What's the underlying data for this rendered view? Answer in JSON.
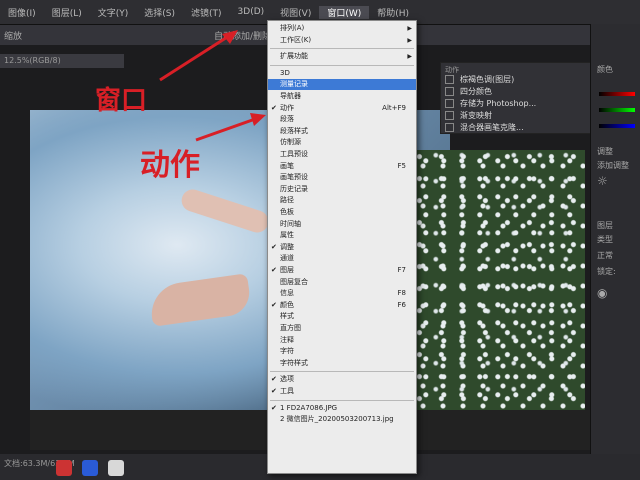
{
  "menubar": {
    "items": [
      {
        "label": "图像(I)"
      },
      {
        "label": "图层(L)"
      },
      {
        "label": "文字(Y)"
      },
      {
        "label": "选择(S)"
      },
      {
        "label": "滤镜(T)"
      },
      {
        "label": "3D(D)"
      },
      {
        "label": "视图(V)"
      },
      {
        "label": "窗口(W)"
      },
      {
        "label": "帮助(H)"
      }
    ]
  },
  "options_bar": {
    "label1": "缩放",
    "auto_add": "自动添加/删除"
  },
  "doc_tab": "12.5%(RGB/8)",
  "status_bar": {
    "doc_size": "文档:63.3M/63.3M"
  },
  "actions_panel": {
    "header": "动作",
    "rows": [
      {
        "label": "棕褐色调(图层)"
      },
      {
        "label": "四分颜色"
      },
      {
        "label": "存储为 Photoshop..."
      },
      {
        "label": "渐变映射"
      },
      {
        "label": "混合器画笔克隆..."
      }
    ]
  },
  "right_panel": {
    "color_tab": "颜色",
    "adjust_tab": "调整",
    "add_adjust": "添加调整",
    "layers_tab": "图层",
    "kind_label": "类型",
    "blend_mode": "正常",
    "lock_label": "锁定:"
  },
  "window_menu": {
    "items": [
      {
        "label": "排列(A)",
        "submenu": true
      },
      {
        "label": "工作区(K)",
        "submenu": true
      },
      {
        "sep": true
      },
      {
        "label": "扩展功能",
        "submenu": true
      },
      {
        "sep": true
      },
      {
        "label": "3D"
      },
      {
        "label": "测量记录",
        "highlighted": true
      },
      {
        "label": "导航器"
      },
      {
        "label": "动作",
        "checked": true,
        "shortcut": "Alt+F9"
      },
      {
        "label": "段落"
      },
      {
        "label": "段落样式"
      },
      {
        "label": "仿制源"
      },
      {
        "label": "工具预设"
      },
      {
        "label": "画笔",
        "shortcut": "F5"
      },
      {
        "label": "画笔预设"
      },
      {
        "label": "历史记录"
      },
      {
        "label": "路径"
      },
      {
        "label": "色板"
      },
      {
        "label": "时间轴"
      },
      {
        "label": "属性"
      },
      {
        "label": "调整",
        "checked": true
      },
      {
        "label": "通道"
      },
      {
        "label": "图层",
        "checked": true,
        "shortcut": "F7"
      },
      {
        "label": "图层复合"
      },
      {
        "label": "信息",
        "shortcut": "F8"
      },
      {
        "label": "颜色",
        "checked": true,
        "shortcut": "F6"
      },
      {
        "label": "样式"
      },
      {
        "label": "直方图"
      },
      {
        "label": "注释"
      },
      {
        "label": "字符"
      },
      {
        "label": "字符样式"
      },
      {
        "sep": true
      },
      {
        "label": "选项",
        "checked": true
      },
      {
        "label": "工具",
        "checked": true
      },
      {
        "sep": true
      },
      {
        "label": "1 FD2A7086.JPG",
        "checked": true
      },
      {
        "label": "2 微信图片_20200503200713.jpg"
      }
    ]
  },
  "annotations": {
    "window_label": "窗口",
    "action_label": "动作",
    "color": "#d81f26"
  },
  "accent_color": "#3d7ad6"
}
